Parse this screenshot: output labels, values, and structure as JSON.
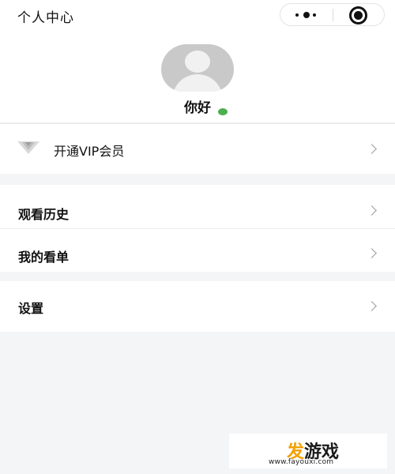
{
  "header": {
    "title": "个人中心",
    "more_icon": "more-dots-icon",
    "close_icon": "target-circle-icon"
  },
  "profile": {
    "avatar_icon": "default-avatar-icon",
    "status_color": "#4caf50",
    "nickname": "你好"
  },
  "menu": {
    "vip": {
      "label": "开通VIP会员",
      "icon": "vip-crown-icon"
    },
    "history": {
      "label": "观看历史"
    },
    "watchlist": {
      "label": "我的看单"
    },
    "settings": {
      "label": "设置"
    },
    "chevron_icon": "chevron-right-icon"
  },
  "watermark": {
    "logo_part_1": "发",
    "logo_part_2": "游戏",
    "url": "www.fayouxi.com"
  },
  "colors": {
    "background": "#f4f5f7",
    "card": "#ffffff",
    "accent": "#f2a100"
  }
}
